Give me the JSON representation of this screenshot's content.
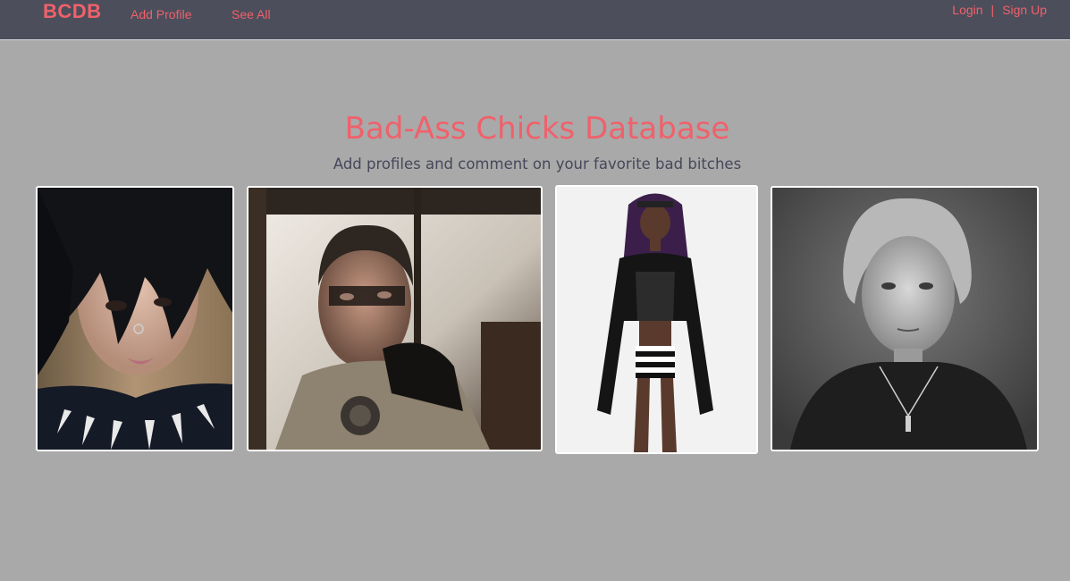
{
  "nav": {
    "brand": "BCDB",
    "add_profile": "Add Profile",
    "see_all": "See All",
    "login": "Login",
    "separator": "|",
    "signup": "Sign Up"
  },
  "hero": {
    "title": "Bad-Ass Chicks Database",
    "subtitle": "Add profiles and comment on your favorite bad bitches"
  },
  "colors": {
    "accent": "#f0616b",
    "navbar": "#4c4e5b",
    "background": "#a9a9a9",
    "subtitle": "#45485a"
  }
}
